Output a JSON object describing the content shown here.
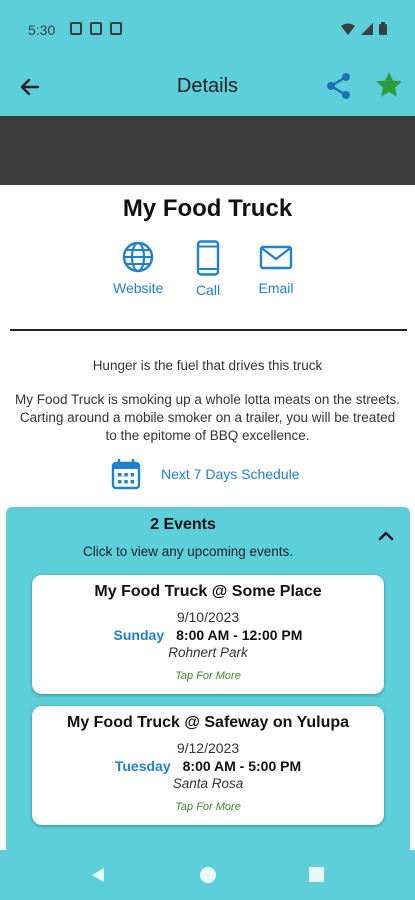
{
  "status_bar": {
    "time": "5:30",
    "left_icons": [
      "notification-icon",
      "sd-card-icon",
      "s-app-icon"
    ],
    "right_icons": [
      "wifi-icon",
      "signal-icon",
      "battery-icon"
    ]
  },
  "app_bar": {
    "title": "Details",
    "back_icon": "arrow-left-icon",
    "share_icon": "share-icon",
    "favorite_icon": "star-icon",
    "favorite_color": "#2e9c3e",
    "icon_color": "#1f6fb8"
  },
  "truck": {
    "name": "My Food Truck",
    "tagline": "Hunger is the fuel that drives this truck",
    "description": "My Food Truck is smoking up a whole lotta meats on the streets. Carting around a mobile smoker on a trailer, you will be treated to the epitome of BBQ excellence."
  },
  "contacts": {
    "website": "Website",
    "call": "Call",
    "email": "Email"
  },
  "schedule": {
    "label": "Next 7 Days Schedule"
  },
  "events": {
    "title": "2 Events",
    "subtitle": "Click to view any upcoming events.",
    "items": [
      {
        "title": "My Food Truck @ Some Place",
        "date": "9/10/2023",
        "day": "Sunday",
        "time": "8:00 AM - 12:00 PM",
        "location": "Rohnert Park",
        "more": "Tap For More"
      },
      {
        "title": "My Food Truck @ Safeway on Yulupa",
        "date": "9/12/2023",
        "day": "Tuesday",
        "time": "8:00 AM - 5:00 PM",
        "location": "Santa Rosa",
        "more": "Tap For More"
      }
    ]
  },
  "colors": {
    "teal": "#5ccfdb",
    "accent_blue": "#1f7fd1",
    "green": "#3d8c2a",
    "banner": "#3c3c3c"
  }
}
